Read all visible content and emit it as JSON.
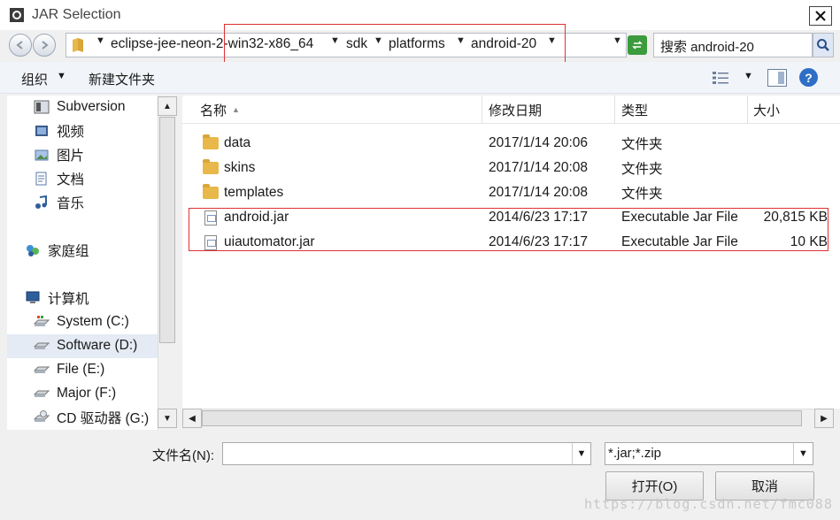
{
  "window": {
    "title": "JAR Selection"
  },
  "address": {
    "crumbs": [
      "eclipse-jee-neon-2-win32-x86_64",
      "sdk",
      "platforms",
      "android-20"
    ],
    "search_placeholder": "搜索 android-20"
  },
  "toolbar": {
    "organize": "组织",
    "new_folder": "新建文件夹"
  },
  "nav": {
    "items": [
      {
        "label": "Subversion",
        "icon": "subversion-icon"
      },
      {
        "label": "视频",
        "icon": "video-library-icon"
      },
      {
        "label": "图片",
        "icon": "pictures-library-icon"
      },
      {
        "label": "文档",
        "icon": "documents-library-icon"
      },
      {
        "label": "音乐",
        "icon": "music-library-icon"
      },
      {
        "label": "家庭组",
        "icon": "homegroup-icon"
      },
      {
        "label": "计算机",
        "icon": "computer-icon"
      },
      {
        "label": "System (C:)",
        "icon": "system-drive-icon"
      },
      {
        "label": "Software (D:)",
        "icon": "drive-icon"
      },
      {
        "label": "File (E:)",
        "icon": "drive-icon"
      },
      {
        "label": "Major (F:)",
        "icon": "drive-icon"
      },
      {
        "label": "CD 驱动器 (G:)",
        "icon": "cd-drive-icon"
      }
    ]
  },
  "columns": [
    "名称",
    "修改日期",
    "类型",
    "大小"
  ],
  "files": [
    {
      "name": "data",
      "date": "2017/1/14 20:06",
      "type": "文件夹",
      "size": "",
      "kind": "folder"
    },
    {
      "name": "skins",
      "date": "2017/1/14 20:08",
      "type": "文件夹",
      "size": "",
      "kind": "folder"
    },
    {
      "name": "templates",
      "date": "2017/1/14 20:08",
      "type": "文件夹",
      "size": "",
      "kind": "folder"
    },
    {
      "name": "android.jar",
      "date": "2014/6/23 17:17",
      "type": "Executable Jar File",
      "size": "20,815 KB",
      "kind": "jar"
    },
    {
      "name": "uiautomator.jar",
      "date": "2014/6/23 17:17",
      "type": "Executable Jar File",
      "size": "10 KB",
      "kind": "jar"
    }
  ],
  "bottom": {
    "filename_label": "文件名(N):",
    "filename_value": "",
    "filetype": "*.jar;*.zip",
    "open_label": "打开(O)",
    "cancel_label": "取消"
  },
  "watermark": "https://blog.csdn.net/fmc088",
  "colors": {
    "highlight_box": "#e03030",
    "selection": "#e4ebf4"
  }
}
